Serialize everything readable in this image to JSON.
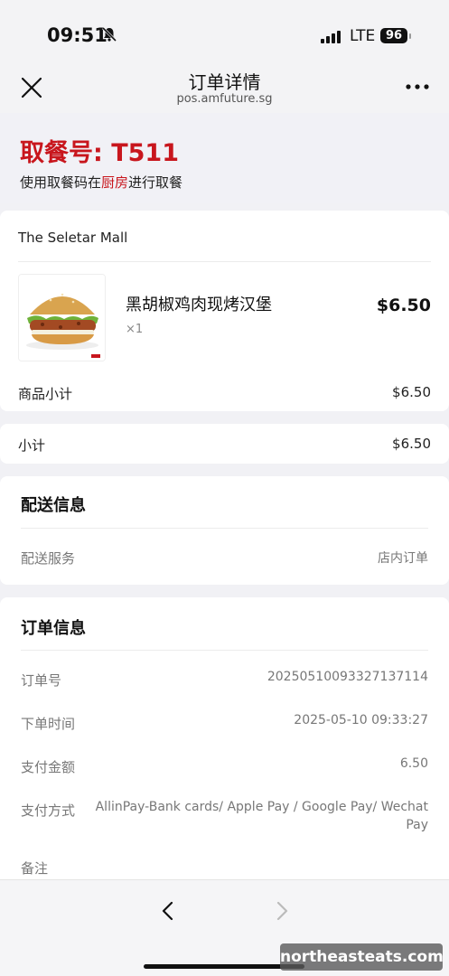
{
  "status_bar": {
    "time": "09:51",
    "network": "LTE",
    "battery": "96"
  },
  "nav": {
    "title": "订单详情",
    "subtitle": "pos.amfuture.sg"
  },
  "pickup": {
    "number_label": "取餐号: T511",
    "hint_prefix": "使用取餐码在",
    "hint_highlight": "厨房",
    "hint_suffix": "进行取餐"
  },
  "store": {
    "name": "The Seletar Mall",
    "item": {
      "name": "黑胡椒鸡肉现烤汉堡",
      "qty": "×1",
      "price": "$6.50"
    },
    "goods_subtotal_label": "商品小计",
    "goods_subtotal_value": "$6.50"
  },
  "subtotal": {
    "label": "小计",
    "value": "$6.50"
  },
  "delivery": {
    "title": "配送信息",
    "service_label": "配送服务",
    "service_value": "店内订单"
  },
  "order": {
    "title": "订单信息",
    "rows": [
      {
        "label": "订单号",
        "value": "20250510093327137114"
      },
      {
        "label": "下单时间",
        "value": "2025-05-10 09:33:27"
      },
      {
        "label": "支付金额",
        "value": "6.50"
      },
      {
        "label": "支付方式",
        "value_line1": "AllinPay-Bank cards/ Apple Pay / Google Pay/ Wechat",
        "value_line2": "Pay"
      },
      {
        "label": "备注",
        "value": ""
      }
    ]
  },
  "watermark": "northeasteats.com",
  "icons": [
    "bell-muted-icon",
    "signal-icon",
    "close-icon",
    "more-icon",
    "back-icon",
    "forward-icon"
  ],
  "colors": {
    "accent_red": "#c8161d",
    "background": "#f1f1f5"
  }
}
